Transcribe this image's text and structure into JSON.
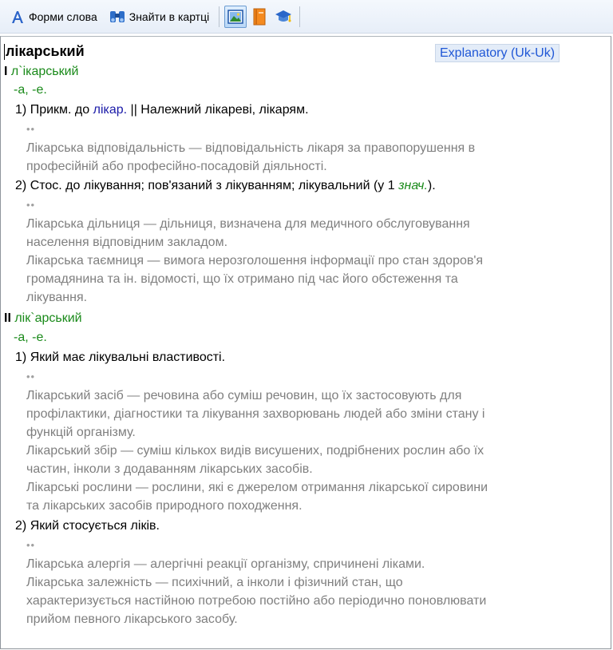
{
  "toolbar": {
    "word_forms_label": "Форми слова",
    "find_in_card_label": "Знайти в картці"
  },
  "entry": {
    "headword": "лікарський",
    "dictionary_badge": "Explanatory (Uk-Uk)",
    "homonym1": {
      "number": "I",
      "stressed_form": "л`ікарський",
      "endings": "-а, -е.",
      "sense1": {
        "number": "1)",
        "text_before_link": "Прикм. до",
        "link": "лікар.",
        "text_after_link": "|| Належний лікареві, лікарям.",
        "marker": "••",
        "example_line1": "Лікарська відповідальність — відповідальність лікаря за правопорушення в",
        "example_line2": "професійній або професійно-посадовій діяльності."
      },
      "sense2": {
        "number": "2)",
        "text_before_abbr": "Стос. до лікування; пов'язаний з лікуванням; лікувальний (у 1",
        "abbr": "знач.",
        "text_after_abbr": ").",
        "marker": "••",
        "example1_line1": "Лікарська дільниця — дільниця, визначена для медичного обслуговування",
        "example1_line2": "населення відповідним закладом.",
        "example2_line1": "Лікарська таємниця — вимога нерозголошення інформації про стан здоров'я",
        "example2_line2": "громадянина та ін. відомості, що їх отримано під час його обстеження та",
        "example2_line3": "лікування."
      }
    },
    "homonym2": {
      "number": "II",
      "stressed_form": "лік`арський",
      "endings": "-а, -е.",
      "sense1": {
        "number": "1)",
        "text": "Який має лікувальні властивості.",
        "marker": "••",
        "example1_line1": "Лікарський засіб — речовина або суміш речовин, що їх застосовують для",
        "example1_line2": "профілактики, діагностики та лікування захворювань людей або зміни стану і",
        "example1_line3": "функцій організму.",
        "example2_line1": "Лікарський збір — суміш кількох видів висушених, подрібнених рослин або їх",
        "example2_line2": "частин, інколи з додаванням лікарських засобів.",
        "example3_line1": "Лікарські рослини — рослини, які є джерелом отримання лікарської сировини",
        "example3_line2": "та лікарських засобів природного походження."
      },
      "sense2": {
        "number": "2)",
        "text": "Який стосується ліків.",
        "marker": "••",
        "example1_line1": "Лікарська алергія — алергічні реакції організму, спричинені ліками.",
        "example2_line1": "Лікарська залежність — психічний, а інколи і фізичний стан, що",
        "example2_line2": "характеризується настійною потребою постійно або періодично поновлювати",
        "example2_line3": "прийом певного лікарського засобу."
      }
    }
  }
}
